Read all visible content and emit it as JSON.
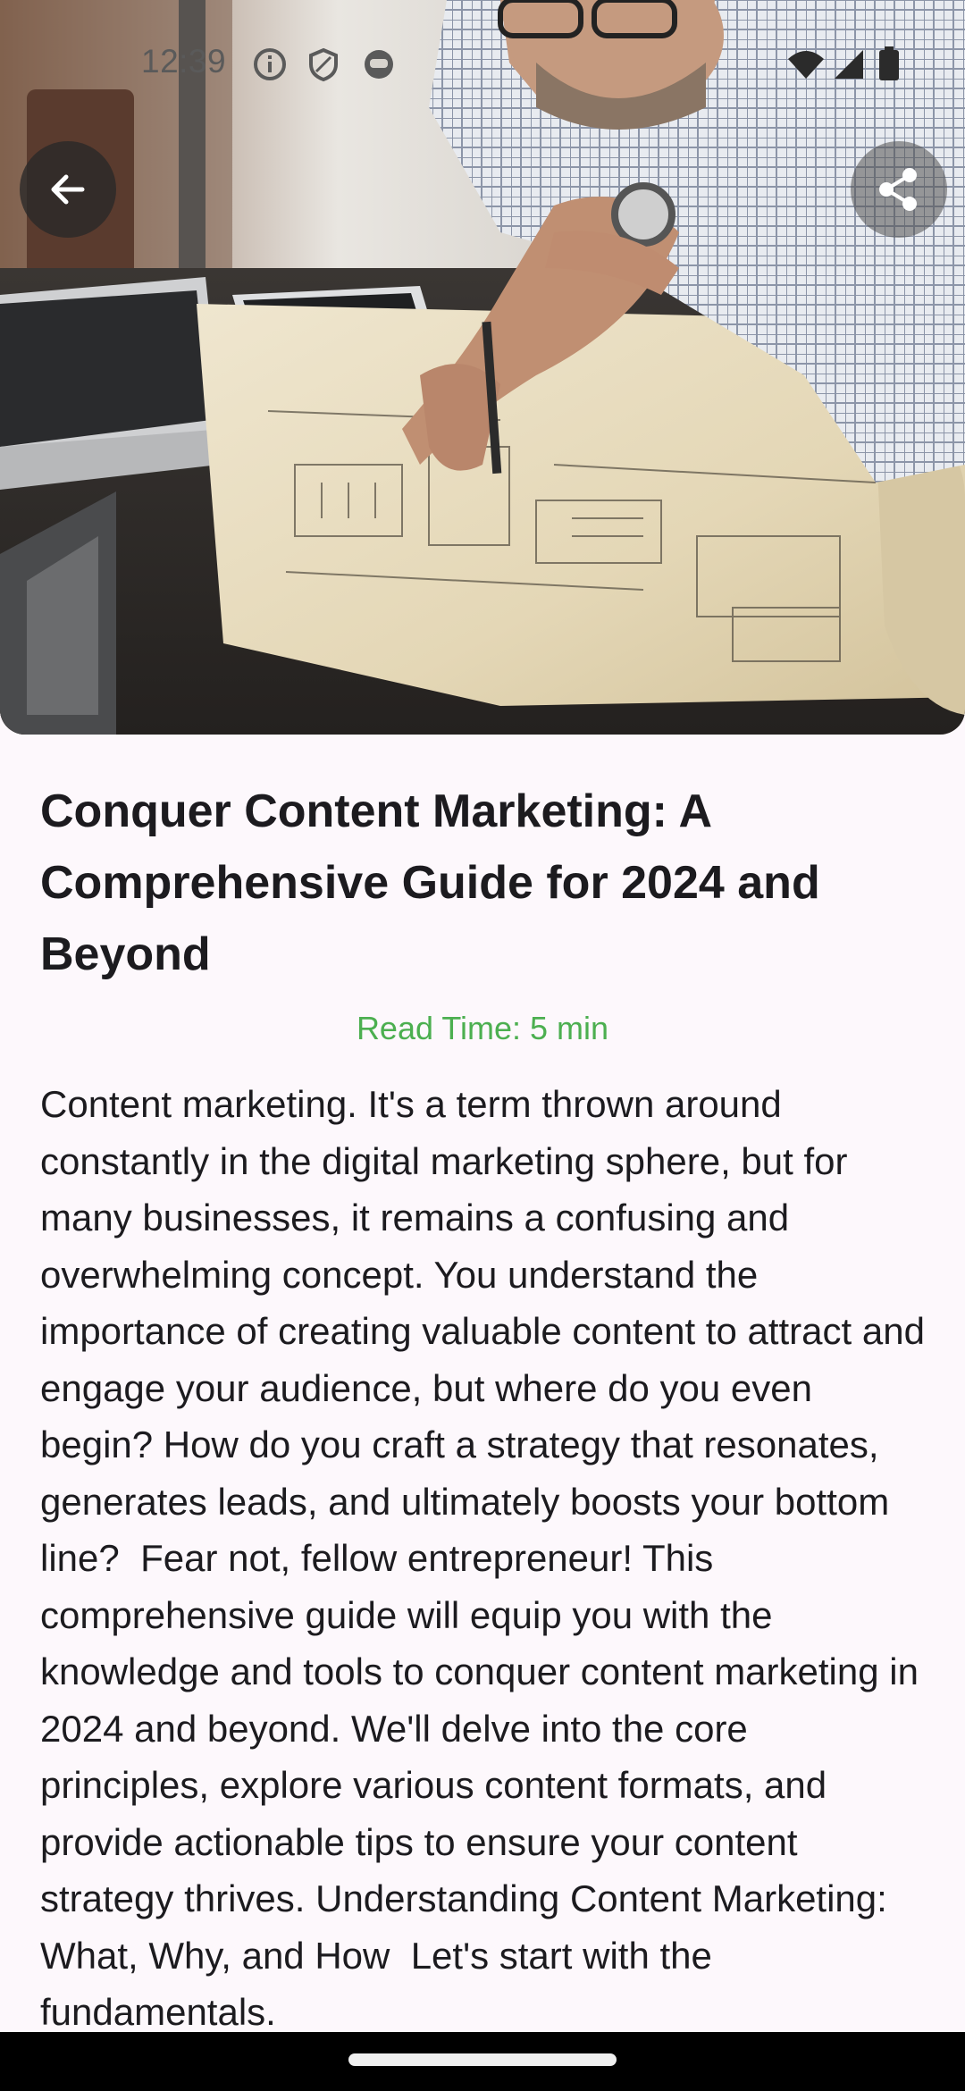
{
  "status_bar": {
    "time": "12:39",
    "left_icons": [
      "info-icon",
      "shield-icon",
      "face-icon"
    ],
    "right_icons": [
      "wifi-icon",
      "signal-icon",
      "battery-icon"
    ]
  },
  "hero": {
    "image": "man-drafting-blueprints-photo",
    "back_icon": "arrow-back-icon",
    "share_icon": "share-icon"
  },
  "article": {
    "title": "Conquer Content Marketing: A Comprehensive Guide for 2024 and Beyond",
    "read_time": "Read Time: 5 min",
    "body": "Content marketing. It's a term thrown around constantly in the digital marketing sphere, but for many businesses, it remains a confusing and overwhelming concept. You understand the importance of creating valuable content to attract and engage your audience, but where do you even begin? How do you craft a strategy that resonates, generates leads, and ultimately boosts your bottom line?  Fear not, fellow entrepreneur! This comprehensive guide will equip you with the knowledge and tools to conquer content marketing in 2024 and beyond. We'll delve into the core principles, explore various content formats, and provide actionable tips to ensure your content strategy thrives. Understanding Content Marketing: What, Why, and How  Let's start with the fundamentals."
  },
  "colors": {
    "background": "#fdf8fc",
    "read_time": "#4caf50",
    "text": "#1c1b1f"
  }
}
